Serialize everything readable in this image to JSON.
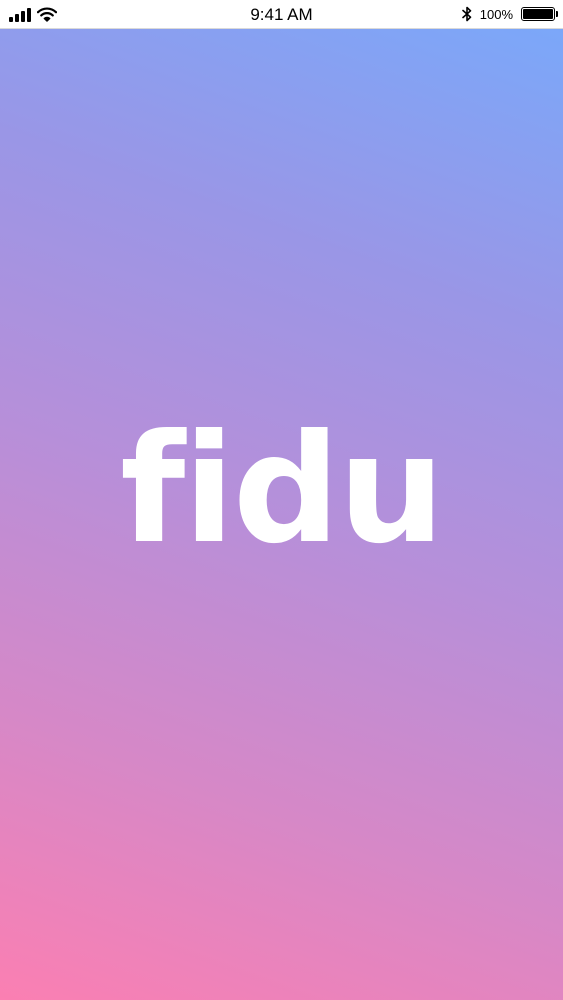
{
  "status_bar": {
    "time": "9:41 AM",
    "battery_percent": "100%",
    "battery_level": 1.0,
    "icons": [
      "cellular-signal-icon",
      "wifi-icon",
      "bluetooth-icon",
      "battery-icon"
    ]
  },
  "splash": {
    "logo_text": "fidu"
  },
  "colors": {
    "gradient_top_right": "#78a9fb",
    "gradient_middle": "#b78fd9",
    "gradient_bottom_left": "#fb7fb2",
    "logo": "#ffffff"
  }
}
